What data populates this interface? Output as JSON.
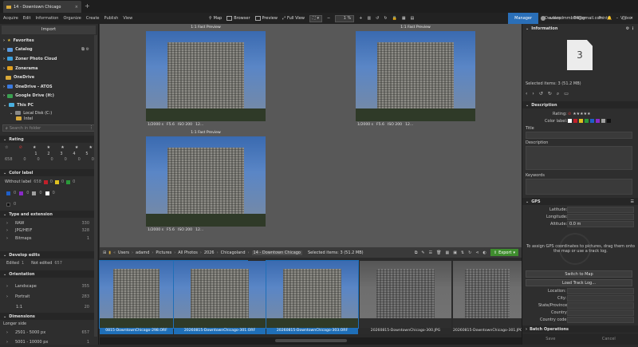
{
  "tab": {
    "title": "14 - Downtown Chicago",
    "close": "×",
    "new": "+"
  },
  "menu": [
    "Acquire",
    "Edit",
    "Information",
    "Organize",
    "Create",
    "Publish",
    "View"
  ],
  "toolbar": {
    "map": "Map",
    "browser": "Browser",
    "preview": "Preview",
    "fullview": "Full View",
    "zoom": "1 %"
  },
  "account": {
    "email": "adamdmmb04@gmail.com"
  },
  "modes": [
    "Manager",
    "Develop",
    "Editor",
    "Print",
    "Video"
  ],
  "left": {
    "import": "Import",
    "tree": [
      "Favorites",
      "Catalog",
      "Zoner Photo Cloud",
      "Zonerama",
      "OneDrive",
      "OneDrive - ATOS",
      "Google Drive (H:)",
      "This PC"
    ],
    "subtree": [
      "Local Disk (C:)",
      "Intel"
    ],
    "search_placeholder": "Search in folder",
    "rating": {
      "title": "Rating",
      "labels": [
        "1",
        "2",
        "3",
        "4",
        "5"
      ],
      "count_prefix": "658",
      "counts": [
        "0",
        "0",
        "0",
        "0",
        "0",
        "0"
      ]
    },
    "colorlabel": {
      "title": "Color label",
      "without": "Without label",
      "without_count": "658",
      "counts": [
        "0",
        "0",
        "0",
        "0",
        "0",
        "0",
        "0",
        "0",
        "0",
        "0",
        "0"
      ]
    },
    "colors": [
      "#c0202a",
      "#e0c020",
      "#2a9a3a",
      "#1f5fc8",
      "#8a2ac8",
      "#a0a0a0",
      "#ffffff",
      "#111111"
    ],
    "type": {
      "title": "Type and extension",
      "items": [
        {
          "label": "RAW",
          "count": "330"
        },
        {
          "label": "JPG/HEIF",
          "count": "328"
        },
        {
          "label": "Bitmaps",
          "count": "1"
        }
      ]
    },
    "develop": {
      "title": "Develop edits",
      "edited": "Edited",
      "edited_count": "1",
      "notedited": "Not edited",
      "notedited_count": "657"
    },
    "orientation": {
      "title": "Orientation",
      "items": [
        {
          "label": "Landscape",
          "count": "355"
        },
        {
          "label": "Portrait",
          "count": "283"
        },
        {
          "label": "1:1",
          "count": "20"
        }
      ]
    },
    "dimensions": {
      "title": "Dimensions",
      "sub": "Longer side",
      "items": [
        {
          "label": "2501 - 5000 px",
          "count": "657"
        },
        {
          "label": "5001 - 10000 px",
          "count": "1"
        }
      ]
    }
  },
  "center": {
    "previews": [
      {
        "label": "1:1 Fast Preview",
        "meta": [
          "1/2000 s",
          "F5.6",
          "ISO 200",
          "12..."
        ]
      },
      {
        "label": "1:1 Fast Preview",
        "meta": [
          "1/2000 s",
          "F5.6",
          "ISO 200",
          "12..."
        ]
      },
      {
        "label": "1:1 Fast Preview",
        "meta": [
          "1/2000 s",
          "F5.6",
          "ISO 200",
          "12..."
        ]
      }
    ]
  },
  "path": {
    "crumbs": [
      "Users",
      "adamd",
      "Pictures",
      "All Photos",
      "2026",
      "Chicagoland",
      "14 - Downtown Chicago"
    ],
    "selected": "Selected items: 3 (51.2 MB)",
    "export": "Export"
  },
  "filmstrip": [
    {
      "name": "0815-DowntownChicago-298.ORF",
      "sel": true,
      "gray": false
    },
    {
      "name": "20260815-DowntownChicago-301.ORF",
      "sel": true,
      "gray": false
    },
    {
      "name": "20260815-DowntownChicago-303.ORF",
      "sel": true,
      "gray": false
    },
    {
      "name": "20260815-DowntownChicago-300.JPG",
      "sel": false,
      "gray": true
    },
    {
      "name": "20260815-DowntownChicago-301.JPG",
      "sel": false,
      "gray": true
    }
  ],
  "right": {
    "info": "Information",
    "count": "3",
    "selected": "Selected items: 3 (51.2 MB)",
    "description": "Description",
    "rating": "Rating:",
    "colorlabel": "Color label:",
    "title": "Title",
    "desc": "Description",
    "keywords": "Keywords",
    "gps": "GPS",
    "latitude": "Latitude:",
    "longitude": "Longitude:",
    "altitude": "Altitude:",
    "altitude_value": "0.0 m",
    "gps_hint": "To assign GPS coordinates to pictures, drag them onto the map or use a track log.",
    "switch_map": "Switch to Map",
    "load_track": "Load Track Log...",
    "location": "Location:",
    "city": "City:",
    "state": "State/Province:",
    "country": "Country:",
    "country_code": "Country code:",
    "batch": "Batch Operations",
    "save": "Save",
    "cancel": "Cancel"
  }
}
